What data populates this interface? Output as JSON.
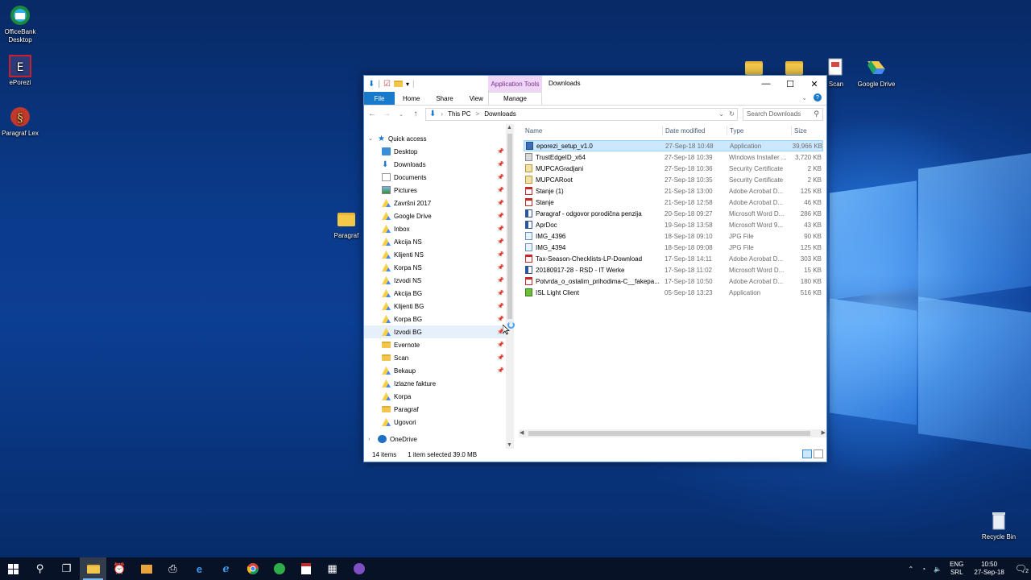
{
  "desktop": {
    "icons": [
      {
        "label": "OfficeBank Desktop",
        "icon": "officebank-icon"
      },
      {
        "label": "ePorezi",
        "icon": "eporezi-icon"
      },
      {
        "label": "Paragraf Lex",
        "icon": "paragraf-lex-icon"
      },
      {
        "label": "Paragraf",
        "icon": "folder-icon"
      },
      {
        "label": "Scan",
        "icon": "scan-icon"
      },
      {
        "label": "Google Drive",
        "icon": "google-drive-icon"
      },
      {
        "label": "Recycle Bin",
        "icon": "recycle-bin-icon"
      }
    ]
  },
  "explorer": {
    "title": "Downloads",
    "context_tab": "Application Tools",
    "tabs": {
      "file": "File",
      "home": "Home",
      "share": "Share",
      "view": "View",
      "manage": "Manage"
    },
    "breadcrumb": {
      "root": "This PC",
      "sep": ">",
      "current": "Downloads"
    },
    "search_placeholder": "Search Downloads",
    "nav": {
      "quick_access": "Quick access",
      "items": [
        {
          "label": "Desktop",
          "icon": "desktop-icon",
          "pinned": true
        },
        {
          "label": "Downloads",
          "icon": "downloads-icon",
          "pinned": true
        },
        {
          "label": "Documents",
          "icon": "documents-icon",
          "pinned": true
        },
        {
          "label": "Pictures",
          "icon": "pictures-icon",
          "pinned": true
        },
        {
          "label": "Završni 2017",
          "icon": "google-drive-icon",
          "pinned": true
        },
        {
          "label": "Google Drive",
          "icon": "google-drive-icon",
          "pinned": true
        },
        {
          "label": "Inbox",
          "icon": "google-drive-icon",
          "pinned": true
        },
        {
          "label": "Akcija NS",
          "icon": "google-drive-icon",
          "pinned": true
        },
        {
          "label": "Klijenti NS",
          "icon": "google-drive-icon",
          "pinned": true
        },
        {
          "label": "Korpa NS",
          "icon": "google-drive-icon",
          "pinned": true
        },
        {
          "label": "Izvodi NS",
          "icon": "google-drive-icon",
          "pinned": true
        },
        {
          "label": "Akcija BG",
          "icon": "google-drive-icon",
          "pinned": true
        },
        {
          "label": "Klijenti BG",
          "icon": "google-drive-icon",
          "pinned": true
        },
        {
          "label": "Korpa BG",
          "icon": "google-drive-icon",
          "pinned": true
        },
        {
          "label": "Izvodi BG",
          "icon": "google-drive-icon",
          "pinned": true
        },
        {
          "label": "Evernote",
          "icon": "folder-icon",
          "pinned": true
        },
        {
          "label": "Scan",
          "icon": "folder-icon",
          "pinned": true
        },
        {
          "label": "Bekaup",
          "icon": "google-drive-icon",
          "pinned": true
        },
        {
          "label": "Izlazne fakture",
          "icon": "google-drive-icon",
          "pinned": false
        },
        {
          "label": "Korpa",
          "icon": "google-drive-icon",
          "pinned": false
        },
        {
          "label": "Paragraf",
          "icon": "folder-icon",
          "pinned": false
        },
        {
          "label": "Ugovori",
          "icon": "google-drive-icon",
          "pinned": false
        }
      ],
      "onedrive": "OneDrive"
    },
    "columns": {
      "name": "Name",
      "date": "Date modified",
      "type": "Type",
      "size": "Size"
    },
    "files": [
      {
        "name": "eporezi_setup_v1.0",
        "date": "27-Sep-18 10:48",
        "type": "Application",
        "size": "39,966 KB",
        "kind": "app",
        "selected": true
      },
      {
        "name": "TrustEdgeID_x64",
        "date": "27-Sep-18 10:39",
        "type": "Windows Installer ...",
        "size": "3,720 KB",
        "kind": "msi"
      },
      {
        "name": "MUPCAGradjani",
        "date": "27-Sep-18 10:36",
        "type": "Security Certificate",
        "size": "2 KB",
        "kind": "cert"
      },
      {
        "name": "MUPCARoot",
        "date": "27-Sep-18 10:35",
        "type": "Security Certificate",
        "size": "2 KB",
        "kind": "cert"
      },
      {
        "name": "Stanje (1)",
        "date": "21-Sep-18 13:00",
        "type": "Adobe Acrobat D...",
        "size": "125 KB",
        "kind": "pdf"
      },
      {
        "name": "Stanje",
        "date": "21-Sep-18 12:58",
        "type": "Adobe Acrobat D...",
        "size": "46 KB",
        "kind": "pdf"
      },
      {
        "name": "Paragraf - odgovor porodična penzija",
        "date": "20-Sep-18 09:27",
        "type": "Microsoft Word D...",
        "size": "286 KB",
        "kind": "word"
      },
      {
        "name": "AprDoc",
        "date": "19-Sep-18 13:58",
        "type": "Microsoft Word 9...",
        "size": "43 KB",
        "kind": "word"
      },
      {
        "name": "IMG_4396",
        "date": "18-Sep-18 09:10",
        "type": "JPG File",
        "size": "90 KB",
        "kind": "jpg"
      },
      {
        "name": "IMG_4394",
        "date": "18-Sep-18 09:08",
        "type": "JPG File",
        "size": "125 KB",
        "kind": "jpg"
      },
      {
        "name": "Tax-Season-Checklists-LP-Download",
        "date": "17-Sep-18 14:11",
        "type": "Adobe Acrobat D...",
        "size": "303 KB",
        "kind": "pdf"
      },
      {
        "name": "20180917-28 - RSD - IT Werke",
        "date": "17-Sep-18 11:02",
        "type": "Microsoft Word D...",
        "size": "15 KB",
        "kind": "word"
      },
      {
        "name": "Potvrda_o_ostalim_prihodima-C__fakepa...",
        "date": "17-Sep-18 10:50",
        "type": "Adobe Acrobat D...",
        "size": "180 KB",
        "kind": "pdf"
      },
      {
        "name": "ISL Light Client",
        "date": "05-Sep-18 13:23",
        "type": "Application",
        "size": "516 KB",
        "kind": "isl"
      }
    ],
    "status": {
      "count": "14 items",
      "selection": "1 item selected  39.0 MB"
    }
  },
  "taskbar": {
    "lang": "ENG",
    "locale": "SRL",
    "time": "10:50",
    "date": "27-Sep-18",
    "notifications": "2"
  }
}
